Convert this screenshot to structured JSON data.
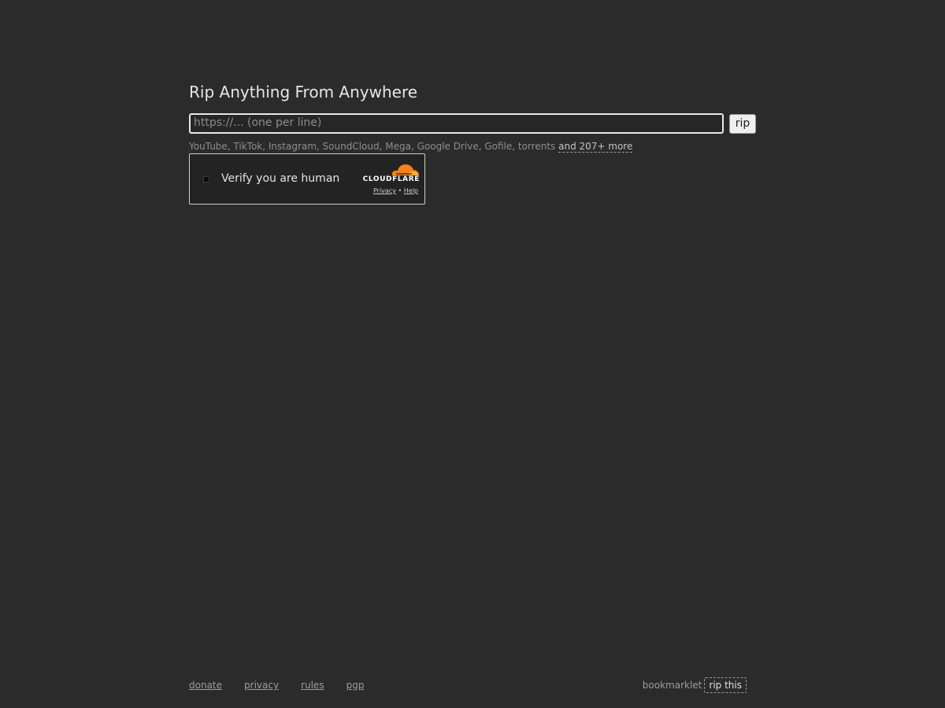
{
  "header": {
    "title": "Rip Anything From Anywhere"
  },
  "form": {
    "url_placeholder": "https://... (one per line)",
    "url_value": "",
    "rip_label": "rip",
    "sites_text": "YouTube, TikTok, Instagram, SoundCloud, Mega, Google Drive, Gofile, torrents",
    "more_label": "and 207+ more"
  },
  "captcha": {
    "label": "Verify you are human",
    "brand": "CLOUDFLARE",
    "privacy_label": "Privacy",
    "separator": "•",
    "help_label": "Help",
    "accent_color": "#f48120"
  },
  "footer": {
    "links": [
      "donate",
      "privacy",
      "rules",
      "pgp"
    ],
    "bookmarklet_label": "bookmarklet",
    "bookmarklet_link": "rip this"
  }
}
